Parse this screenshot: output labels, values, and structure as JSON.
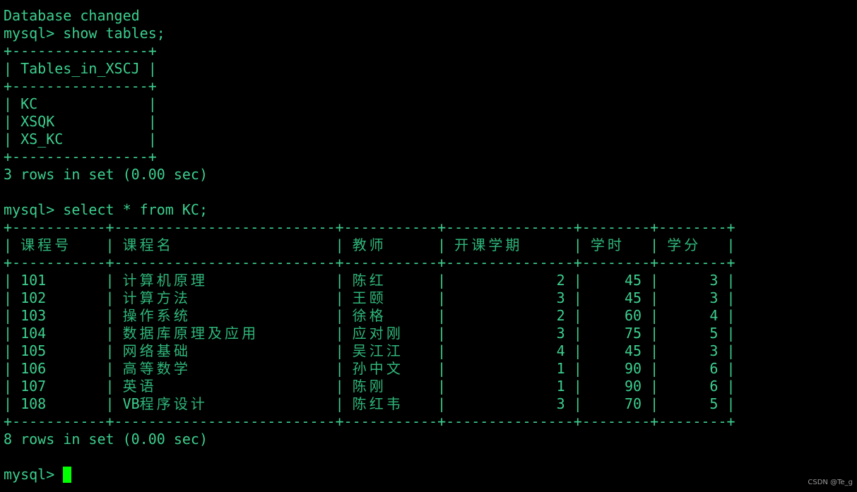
{
  "terminal": {
    "prompt": "mysql> ",
    "lines_before": [
      "Database changed"
    ],
    "command1": "show tables;",
    "tables_result": {
      "header": "Tables_in_XSCJ",
      "rows": [
        "KC",
        "XSQK",
        "XS_KC"
      ],
      "summary": "3 rows in set (0.00 sec)"
    },
    "command2": "select * from KC;",
    "kc_result": {
      "columns": [
        "课程号",
        "课程名",
        "教师",
        "开课学期",
        "学时",
        "学分"
      ],
      "rows": [
        [
          "101",
          "计算机原理",
          "陈红",
          "2",
          "45",
          "3"
        ],
        [
          "102",
          "计算方法",
          "王颐",
          "3",
          "45",
          "3"
        ],
        [
          "103",
          "操作系统",
          "徐格",
          "2",
          "60",
          "4"
        ],
        [
          "104",
          "数据库原理及应用",
          "应对刚",
          "3",
          "75",
          "5"
        ],
        [
          "105",
          "网络基础",
          "吴江江",
          "4",
          "45",
          "3"
        ],
        [
          "106",
          "高等数学",
          "孙中文",
          "1",
          "90",
          "6"
        ],
        [
          "107",
          "英语",
          "陈刚",
          "1",
          "90",
          "6"
        ],
        [
          "108",
          "VB程序设计",
          "陈红韦",
          "3",
          "70",
          "5"
        ]
      ],
      "summary": "8 rows in set (0.00 sec)"
    }
  },
  "watermark": "CSDN @Te_g",
  "colors": {
    "text": "#3ccf8e",
    "cursor": "#00ff00",
    "background": "#000000"
  }
}
